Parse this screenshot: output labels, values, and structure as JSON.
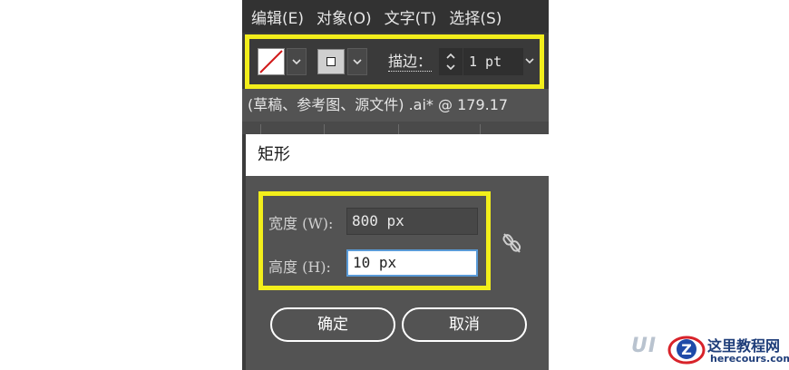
{
  "menu": {
    "items": [
      "编辑(E)",
      "对象(O)",
      "文字(T)",
      "选择(S)"
    ]
  },
  "control_bar": {
    "stroke_label": "描边：",
    "stroke_value": "1 pt",
    "fill_icon": "no-fill-swatch",
    "stroke_icon": "stroke-swatch",
    "highlight_color": "#f2ee1b"
  },
  "document": {
    "tab_title": "(草稿、参考图、源文件) .ai* @ 179.17"
  },
  "dialog": {
    "title": "矩形",
    "width_label": "宽度 (W):",
    "width_value": "800 px",
    "height_label": "高度 (H):",
    "height_value": "10 px",
    "link_icon": "unlink-constrain-proportions-icon",
    "ok_label": "确定",
    "cancel_label": "取消"
  },
  "watermark": {
    "faded_text": "UI",
    "name": "这里教程网",
    "url": "herecours.com",
    "logo_letter": "Z"
  }
}
